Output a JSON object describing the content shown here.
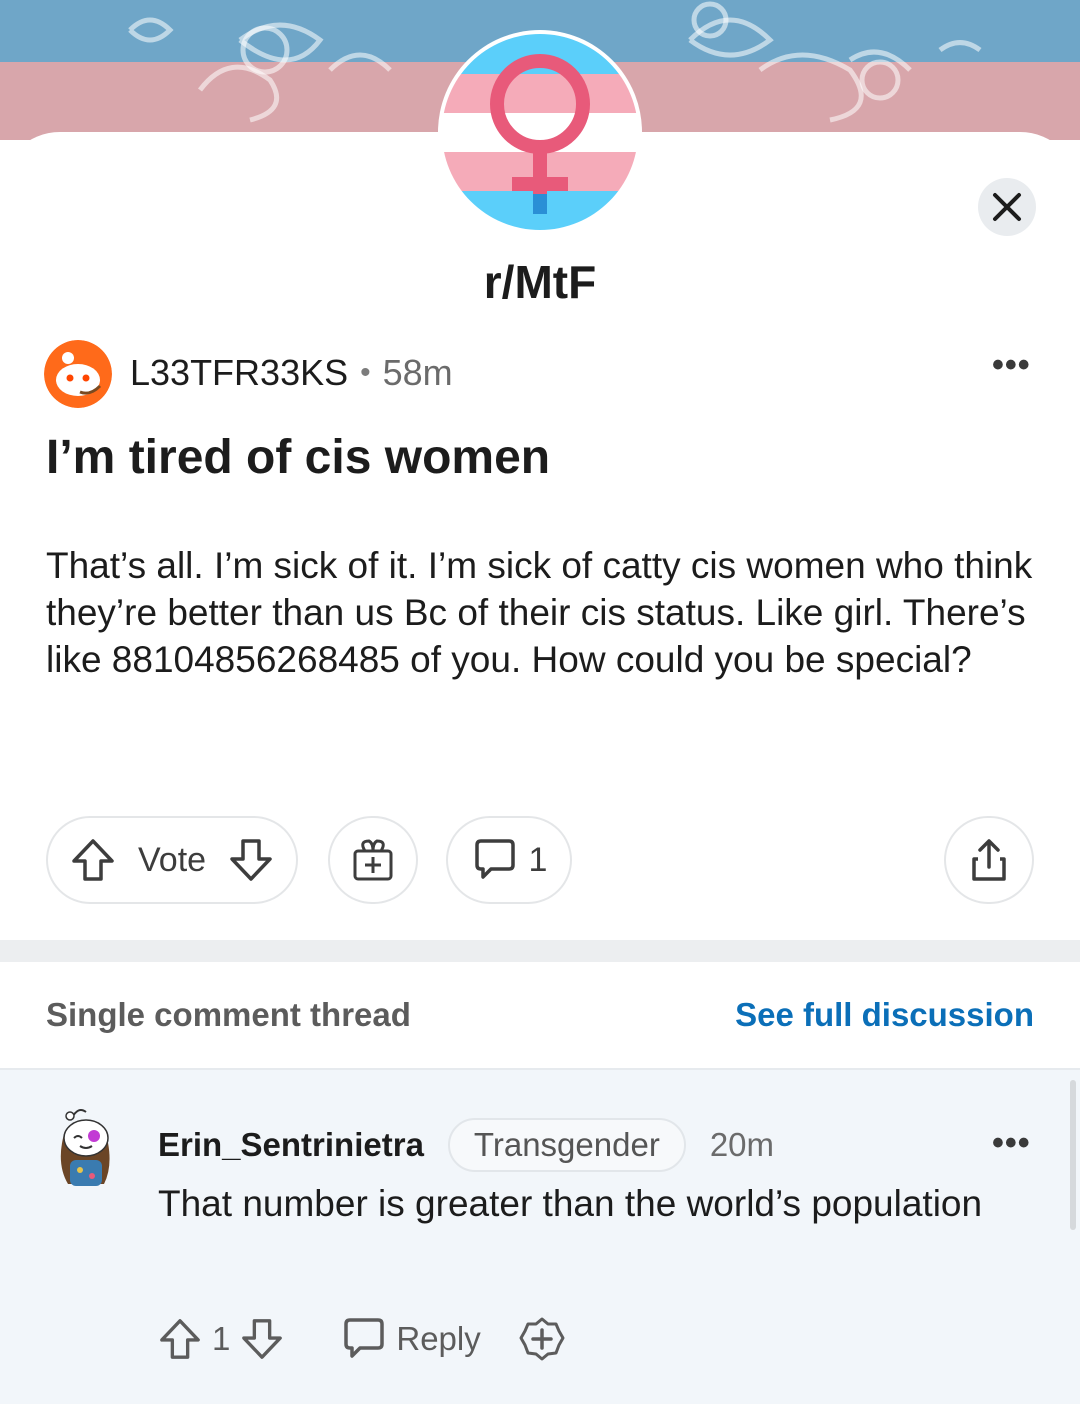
{
  "banner": {
    "colors": {
      "blue": "#6fa6c8",
      "pink": "#d8a6ab"
    }
  },
  "community": {
    "name": "r/MtF",
    "icon": "female-symbol-icon",
    "flag_colors": [
      "#5bcffa",
      "#f5abb9",
      "#ffffff",
      "#f5abb9",
      "#5bcffa"
    ]
  },
  "post": {
    "author": "L33TFR33KS",
    "separator": "•",
    "time": "58m",
    "title": "I’m tired of cis women",
    "body": "That’s all. I’m sick of it. I’m sick of catty cis women who think they’re better than us Bc of their cis status. Like girl. There’s like 88104856268485 of you. How could you be special?",
    "more_label": "•••",
    "actions": {
      "vote_label": "Vote",
      "comment_count": "1"
    }
  },
  "thread": {
    "label": "Single comment thread",
    "see_full": "See full discussion"
  },
  "comment": {
    "author": "Erin_Sentrinietra",
    "flair": "Transgender",
    "time": "20m",
    "body": "That number is greater than the world’s population",
    "more_label": "•••",
    "vote_count": "1",
    "reply_label": "Reply"
  },
  "theme": {
    "link_color": "#0b6fb8",
    "comment_bg": "#f2f6fa"
  }
}
